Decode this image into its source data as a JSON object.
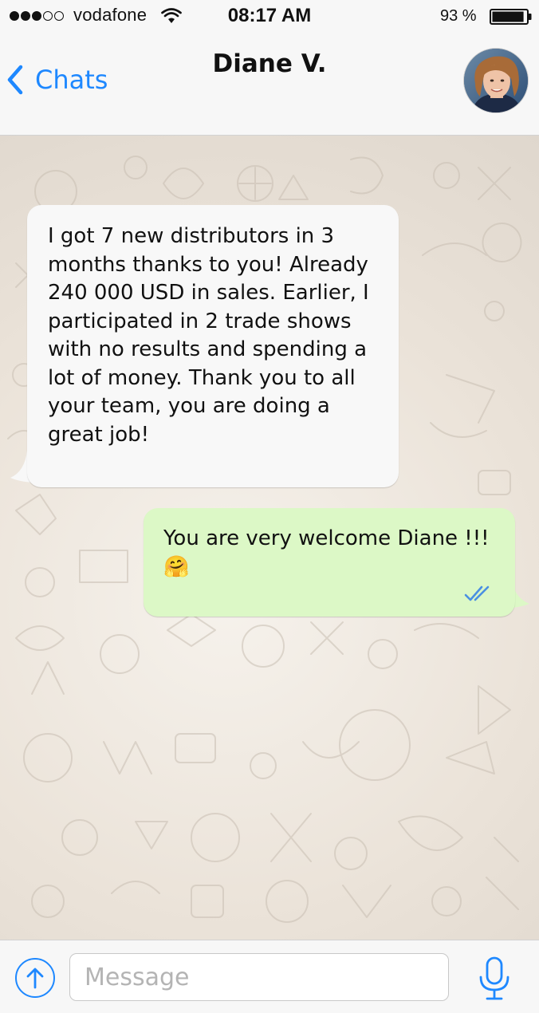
{
  "status_bar": {
    "signal_total": 5,
    "signal_filled": 3,
    "carrier": "vodafone",
    "time": "08:17 AM",
    "battery_percent": "93 %",
    "battery_level": 0.93,
    "icons": [
      "signal-dots-icon",
      "wifi-icon",
      "battery-icon"
    ]
  },
  "nav": {
    "back_label": "Chats",
    "back_icon": "chevron-left-icon",
    "title": "Diane V.",
    "avatar_icon": "avatar-photo"
  },
  "messages": [
    {
      "direction": "incoming",
      "text": "I got 7 new distributors in 3 months thanks to you! Already 240 000 USD in sales. Earlier, I participated in 2 trade shows with no results and spending a lot of money. Thank you to all your team, you are doing a great job!"
    },
    {
      "direction": "outgoing",
      "text": "You are very welcome Diane !!!",
      "emoji": "🤗",
      "status_icon": "double-check-icon"
    }
  ],
  "input_bar": {
    "upload_icon": "upload-arrow-icon",
    "placeholder": "Message",
    "mic_icon": "microphone-icon"
  },
  "colors": {
    "accent": "#1e88ff",
    "incoming_bubble": "#f8f8f8",
    "outgoing_bubble": "#dcf8c6",
    "wallpaper": "#ebe3d9",
    "read_ticks": "#4a90e2"
  }
}
